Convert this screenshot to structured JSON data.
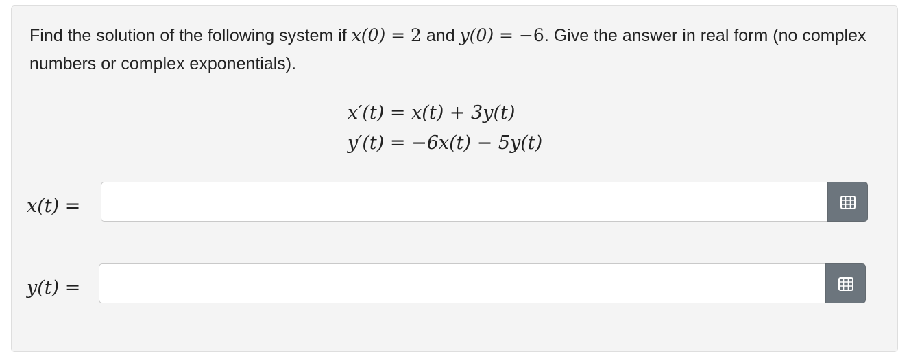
{
  "question": {
    "text_before_x0": "Find the solution of the following system if ",
    "x0_expr": "x(0)",
    "x0_value": "2",
    "and_word": " and ",
    "y0_expr": "y(0)",
    "y0_value": "−6",
    "text_after_y0": ". Give the answer in real form (no complex numbers or complex exponentials)."
  },
  "equations": [
    {
      "lhs": "x′(t)",
      "rhs": "x(t) + 3y(t)"
    },
    {
      "lhs": "y′(t)",
      "rhs": "−6x(t) − 5y(t)"
    }
  ],
  "answers": [
    {
      "label": "x(t) =",
      "value": "",
      "button_icon": "matrix-grid-icon"
    },
    {
      "label": "y(t) =",
      "value": "",
      "button_icon": "matrix-grid-icon"
    }
  ],
  "colors": {
    "card_background": "#f4f4f4",
    "button_background": "#6c757d",
    "text": "#222222"
  }
}
